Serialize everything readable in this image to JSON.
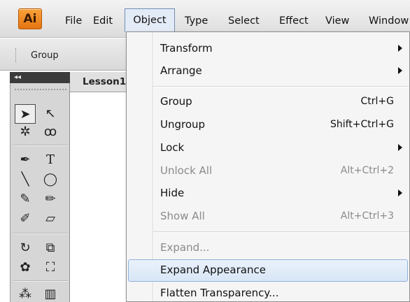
{
  "menubar": {
    "logo_text": "Ai",
    "items": [
      "File",
      "Edit",
      "Object",
      "Type",
      "Select",
      "Effect",
      "View",
      "Window"
    ],
    "active": "Object"
  },
  "controlbar": {
    "selection_label": "Group"
  },
  "document": {
    "tab_label": "Lesson1"
  },
  "tools": {
    "collapse_glyph": "◂◂",
    "items": [
      {
        "name": "selection-tool-icon",
        "glyph": "➤"
      },
      {
        "name": "direct-selection-tool-icon",
        "glyph": "↖"
      },
      {
        "name": "magic-wand-tool-icon",
        "glyph": "✲"
      },
      {
        "name": "lasso-tool-icon",
        "glyph": "ꝏ"
      },
      {
        "name": "pen-tool-icon",
        "glyph": "✒"
      },
      {
        "name": "type-tool-icon",
        "glyph": "T"
      },
      {
        "name": "line-tool-icon",
        "glyph": "╲"
      },
      {
        "name": "ellipse-tool-icon",
        "glyph": "◯"
      },
      {
        "name": "paintbrush-tool-icon",
        "glyph": "✎"
      },
      {
        "name": "pencil-tool-icon",
        "glyph": "✏"
      },
      {
        "name": "blob-brush-tool-icon",
        "glyph": "✐"
      },
      {
        "name": "eraser-tool-icon",
        "glyph": "▱"
      },
      {
        "name": "rotate-tool-icon",
        "glyph": "↻"
      },
      {
        "name": "scale-tool-icon",
        "glyph": "⧉"
      },
      {
        "name": "warp-tool-icon",
        "glyph": "✿"
      },
      {
        "name": "free-transform-tool-icon",
        "glyph": "⛶"
      },
      {
        "name": "symbol-sprayer-tool-icon",
        "glyph": "⁂"
      },
      {
        "name": "column-graph-tool-icon",
        "glyph": "▥"
      }
    ]
  },
  "object_menu": {
    "items": [
      {
        "label": "Transform",
        "shortcut": "",
        "submenu": true,
        "disabled": false,
        "highlighted": false
      },
      {
        "label": "Arrange",
        "shortcut": "",
        "submenu": true,
        "disabled": false,
        "highlighted": false
      },
      {
        "label": "Group",
        "shortcut": "Ctrl+G",
        "submenu": false,
        "disabled": false,
        "highlighted": false
      },
      {
        "label": "Ungroup",
        "shortcut": "Shift+Ctrl+G",
        "submenu": false,
        "disabled": false,
        "highlighted": false
      },
      {
        "label": "Lock",
        "shortcut": "",
        "submenu": true,
        "disabled": false,
        "highlighted": false
      },
      {
        "label": "Unlock All",
        "shortcut": "Alt+Ctrl+2",
        "submenu": false,
        "disabled": true,
        "highlighted": false
      },
      {
        "label": "Hide",
        "shortcut": "",
        "submenu": true,
        "disabled": false,
        "highlighted": false
      },
      {
        "label": "Show All",
        "shortcut": "Alt+Ctrl+3",
        "submenu": false,
        "disabled": true,
        "highlighted": false
      },
      {
        "label": "Expand...",
        "shortcut": "",
        "submenu": false,
        "disabled": true,
        "highlighted": false
      },
      {
        "label": "Expand Appearance",
        "shortcut": "",
        "submenu": false,
        "disabled": false,
        "highlighted": true
      },
      {
        "label": "Flatten Transparency...",
        "shortcut": "",
        "submenu": false,
        "disabled": false,
        "highlighted": false
      }
    ]
  },
  "colors": {
    "menu_hover_border": "#8fb2dc",
    "menu_disabled_text": "#8a8a8a",
    "logo_orange": "#e47412"
  }
}
